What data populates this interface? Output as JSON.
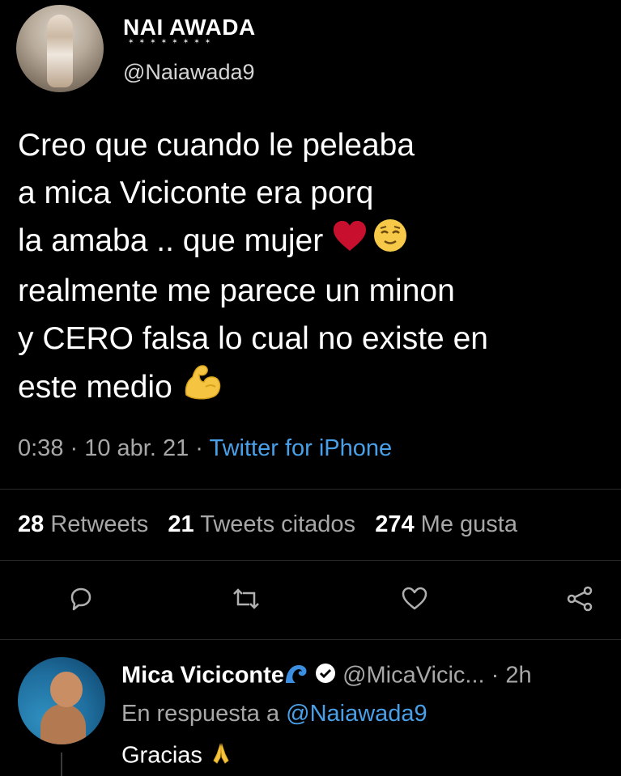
{
  "tweet": {
    "author": {
      "name": "NAI AWADA",
      "handle": "@Naiawada9"
    },
    "lines": [
      "Creo que cuando le peleaba",
      "a mica Viciconte era porq",
      "la amaba .. que mujer",
      "realmente me parece un minon",
      "y CERO falsa lo cual no existe en",
      "este medio"
    ],
    "emoji": {
      "line3": [
        "heart-icon",
        "relieved-face-icon"
      ],
      "line6": [
        "flexed-biceps-icon"
      ]
    },
    "meta": {
      "time": "0:38",
      "separator": " · ",
      "date": "10 abr. 21",
      "source": "Twitter for iPhone"
    },
    "stats": {
      "retweets_count": "28",
      "retweets_label": "Retweets",
      "quotes_count": "21",
      "quotes_label": "Tweets citados",
      "likes_count": "274",
      "likes_label": "Me gusta"
    },
    "actions": [
      "reply-icon",
      "retweet-icon",
      "like-icon",
      "share-icon"
    ]
  },
  "reply": {
    "name": "Mica Viciconte",
    "badges": [
      "wave-icon",
      "verified-icon"
    ],
    "handle": "@MicaVicic...",
    "separator": " · ",
    "time": "2h",
    "replying_to_label": "En respuesta a",
    "replying_to": "@Naiawada9",
    "text": "Gracias",
    "text_emoji": "folded-hands-icon"
  },
  "colors": {
    "background": "#000000",
    "text": "#ffffff",
    "secondary": "#a8a8a8",
    "link": "#4aa0e8",
    "divider": "#2a2a2a"
  }
}
